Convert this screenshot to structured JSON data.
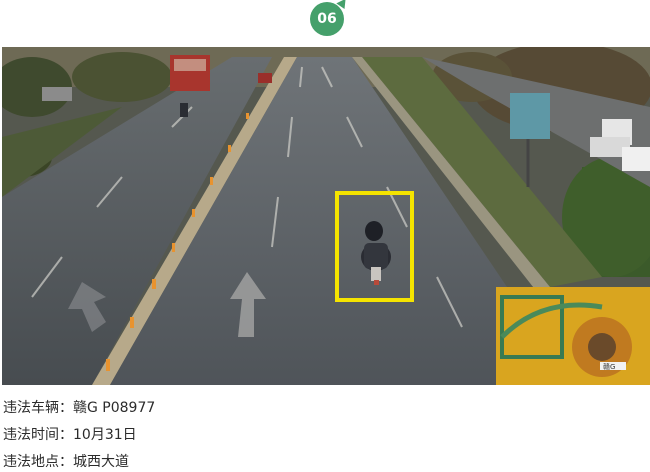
{
  "badge": {
    "number": "06"
  },
  "photo": {
    "subject": "violating-motorcycle",
    "highlight_color": "#f5e400",
    "truck_plate": "赣G"
  },
  "details": [
    {
      "label": "违法车辆：",
      "value": "赣G P08977"
    },
    {
      "label": "违法时间：",
      "value": "10月31日"
    },
    {
      "label": "违法地点：",
      "value": "城西大道"
    }
  ]
}
